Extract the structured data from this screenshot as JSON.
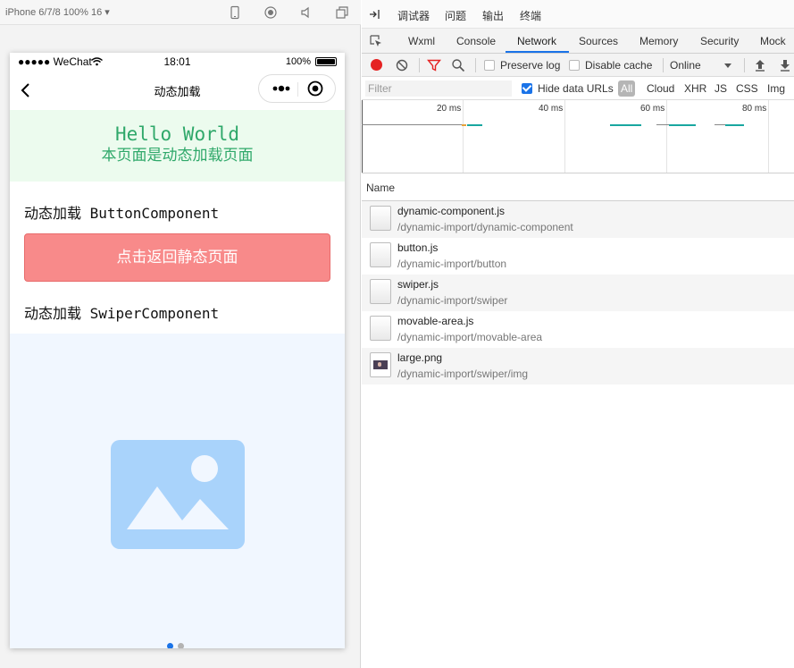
{
  "simulator": {
    "device_label": "iPhone 6/7/8 100% 16 ▾",
    "toolbar_icons": [
      "phone-icon",
      "record-icon",
      "volume-icon",
      "window-icon"
    ]
  },
  "phone": {
    "statusbar": {
      "carrier": "●●●●● WeChat",
      "time": "18:01",
      "battery": "100%"
    },
    "navbar": {
      "title": "动态加载"
    },
    "hello": {
      "line1": "Hello World",
      "line2": "本页面是动态加载页面"
    },
    "button_section_label": "动态加载 ButtonComponent",
    "back_button_label": "点击返回静态页面",
    "swiper_section_label": "动态加载 SwiperComponent",
    "swiper": {
      "slides": 2,
      "active_index": 0,
      "placeholder_icon": "image-placeholder-icon"
    }
  },
  "devtools": {
    "top_tabs": [
      "调试器",
      "问题",
      "输出",
      "终端"
    ],
    "active_top_tab": "调试器",
    "panel_tabs": [
      "Wxml",
      "Console",
      "Network",
      "Sources",
      "Memory",
      "Security",
      "Mock"
    ],
    "active_panel_tab": "Network",
    "toolbar": {
      "preserve_log": "Preserve log",
      "disable_cache": "Disable cache",
      "throttle": "Online"
    },
    "filter": {
      "placeholder": "Filter",
      "hide_data_urls": "Hide data URLs",
      "types": [
        "All",
        "Cloud",
        "XHR",
        "JS",
        "CSS",
        "Img"
      ],
      "active_type": "All"
    },
    "timeline": {
      "ticks": [
        "20 ms",
        "40 ms",
        "60 ms",
        "80 ms"
      ]
    },
    "requests_header": "Name",
    "requests": [
      {
        "name": "dynamic-component.js",
        "path": "/dynamic-import/dynamic-component",
        "type": "js"
      },
      {
        "name": "button.js",
        "path": "/dynamic-import/button",
        "type": "js"
      },
      {
        "name": "swiper.js",
        "path": "/dynamic-import/swiper",
        "type": "js"
      },
      {
        "name": "movable-area.js",
        "path": "/dynamic-import/movable-area",
        "type": "js"
      },
      {
        "name": "large.png",
        "path": "/dynamic-import/swiper/img",
        "type": "img"
      }
    ]
  },
  "colors": {
    "hello_bg": "#ecfbee",
    "hello_text": "#2fa86a",
    "button_bg": "#f88a8a",
    "swiper_bg": "#f1f7ff",
    "placeholder_icon": "#a9d3fb",
    "dot_active": "#1a73e8",
    "record": "#e52222",
    "network_tab_underline": "#1a73e8"
  }
}
